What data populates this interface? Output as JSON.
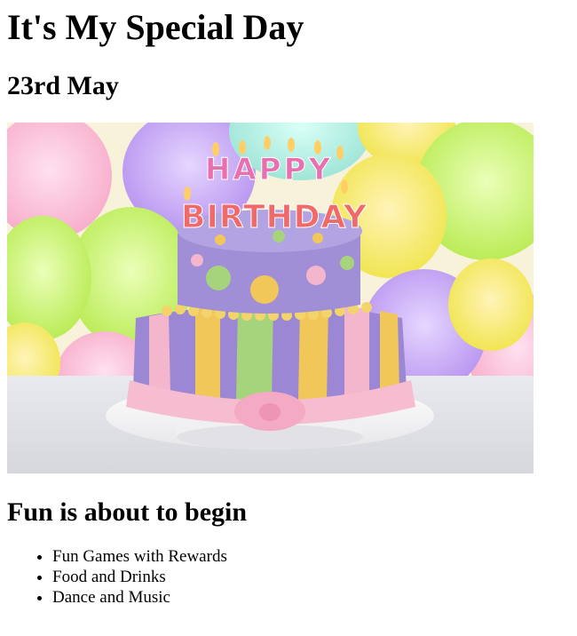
{
  "title": "It's My Special Day",
  "date": "23rd May",
  "image": {
    "icon": "birthday-cake-image",
    "topper_line1": "HAPPY",
    "topper_line2": "BIRTHDAY",
    "colors": {
      "cake_top": "#a08fd6",
      "cake_bottom": "#9b87d3",
      "stripe_yellow": "#f1c75a",
      "stripe_pink": "#f3b6cd",
      "stripe_green": "#a6d47c",
      "ribbon": "#f6bcd0",
      "plate": "#f5f5f5"
    }
  },
  "section_heading": "Fun is about to begin",
  "items": [
    "Fun Games with Rewards",
    "Food and Drinks",
    "Dance and Music"
  ]
}
